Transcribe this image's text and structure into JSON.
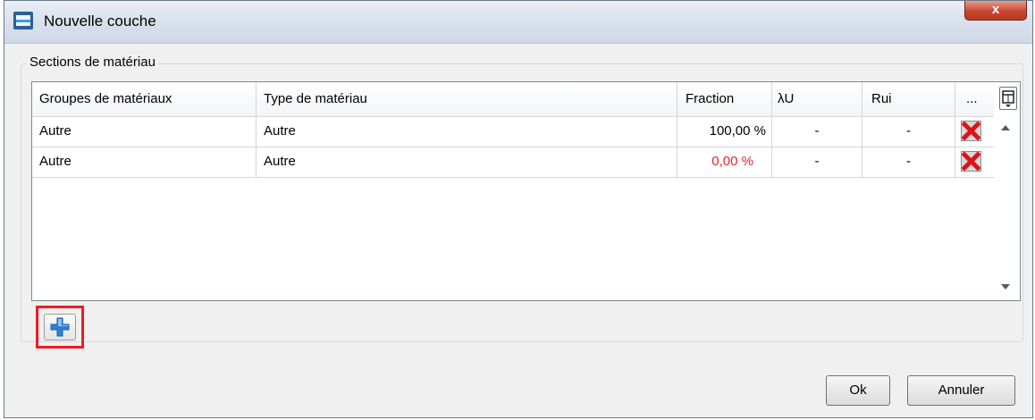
{
  "window": {
    "title": "Nouvelle couche",
    "close_label": "x"
  },
  "group": {
    "label": "Sections de matériau"
  },
  "table": {
    "columns": [
      "Groupes de matériaux",
      "Type de matériau",
      "Fraction",
      "λU",
      "Rui",
      "..."
    ],
    "rows": [
      {
        "group": "Autre",
        "type": "Autre",
        "fraction": "100,00 %",
        "lambda_u": "-",
        "rui": "-",
        "fraction_color": "#000000"
      },
      {
        "group": "Autre",
        "type": "Autre",
        "fraction": "0,00 %",
        "lambda_u": "-",
        "rui": "-",
        "fraction_color": "#e8212b"
      }
    ]
  },
  "icons": {
    "app": "window-app-icon",
    "delete": "delete-x-icon",
    "add": "add-plus-icon",
    "column_chooser": "column-chooser-icon"
  },
  "buttons": {
    "ok": "Ok",
    "cancel": "Annuler"
  },
  "colors": {
    "highlight": "#ee1c25",
    "delete_red": "#d9151b",
    "add_blue": "#2f7fd6"
  }
}
